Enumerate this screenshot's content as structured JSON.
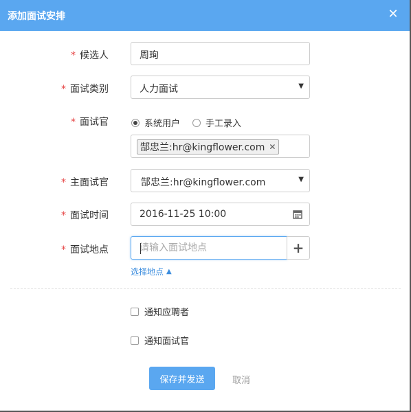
{
  "dialog": {
    "title": "添加面试安排",
    "close_glyph": "✕"
  },
  "form": {
    "candidate": {
      "label": "候选人",
      "value": "周珣"
    },
    "interview_type": {
      "label": "面试类别",
      "value": "人力面试"
    },
    "interviewer": {
      "label": "面试官",
      "options": [
        "系统用户",
        "手工录入"
      ],
      "selected": "系统用户",
      "tags": [
        {
          "text": "郜忠兰:hr@kingflower.com",
          "remove": "✕"
        }
      ]
    },
    "lead_interviewer": {
      "label": "主面试官",
      "value": "郜忠兰:hr@kingflower.com"
    },
    "interview_time": {
      "label": "面试时间",
      "value": "2016-11-25 10:00"
    },
    "interview_location": {
      "label": "面试地点",
      "placeholder": "请输入面试地点",
      "add_glyph": "+",
      "choose_link": "选择地点",
      "choose_caret": "▲"
    },
    "required_mark": "*",
    "dropdown_caret": "▼"
  },
  "notifications": {
    "notify_candidate": {
      "label": "通知应聘者",
      "checked": false
    },
    "notify_interviewer": {
      "label": "通知面试官",
      "checked": false
    }
  },
  "actions": {
    "save_send": "保存并发送",
    "cancel": "取消"
  },
  "colors": {
    "header": "#5aa7f0",
    "primary_button": "#5aa7f0",
    "required": "#e64545",
    "link": "#3c8dde"
  }
}
